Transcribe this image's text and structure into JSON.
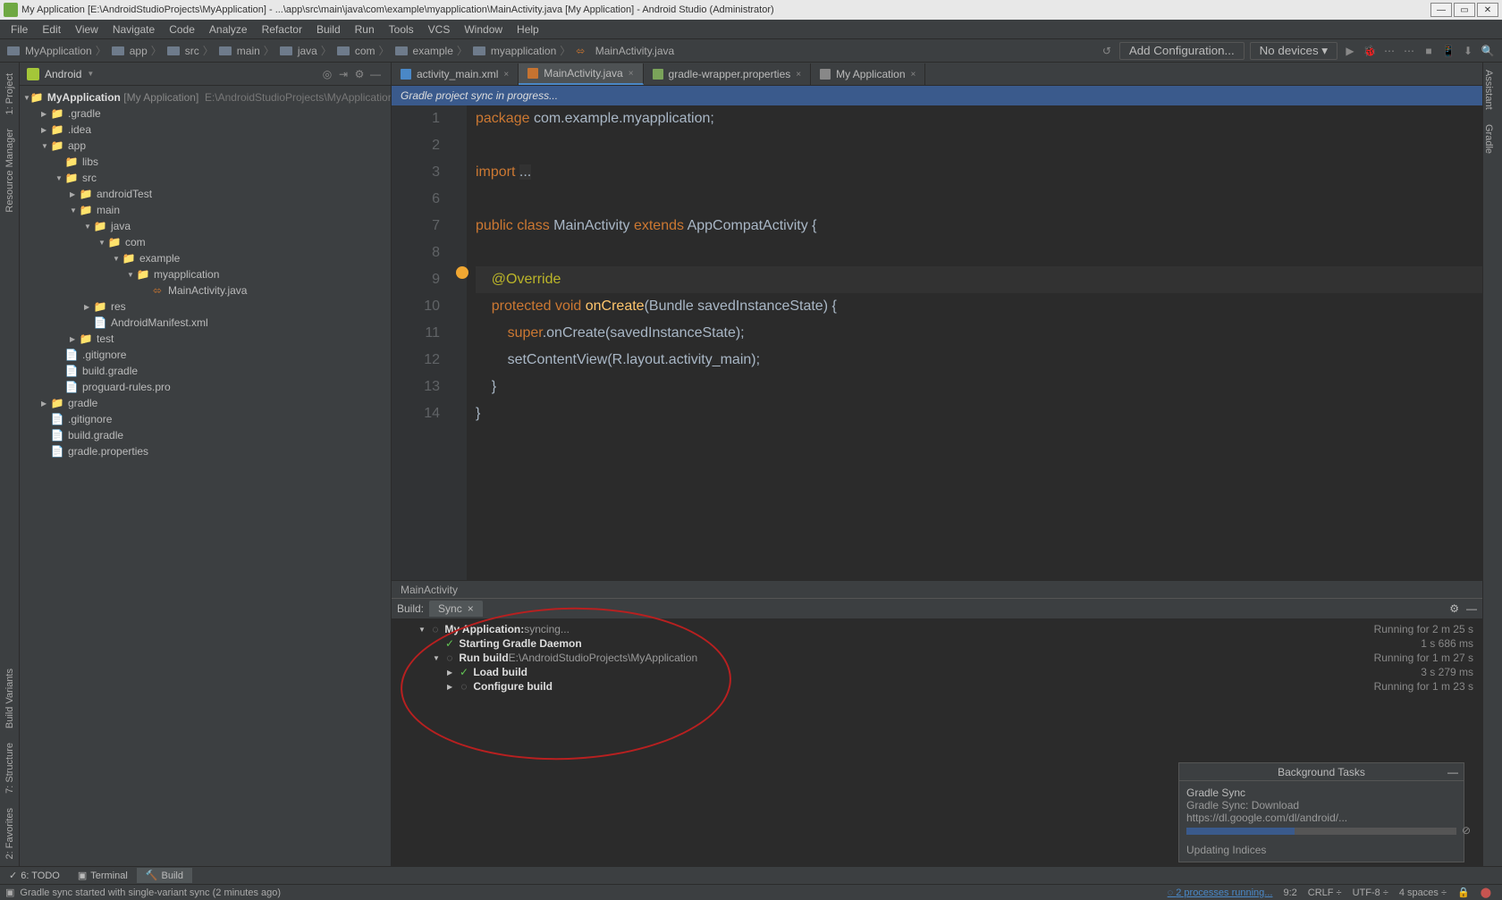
{
  "window": {
    "title": "My Application [E:\\AndroidStudioProjects\\MyApplication] - ...\\app\\src\\main\\java\\com\\example\\myapplication\\MainActivity.java [My Application] - Android Studio (Administrator)"
  },
  "menu": [
    "File",
    "Edit",
    "View",
    "Navigate",
    "Code",
    "Analyze",
    "Refactor",
    "Build",
    "Run",
    "Tools",
    "VCS",
    "Window",
    "Help"
  ],
  "breadcrumbs": [
    "MyApplication",
    "app",
    "src",
    "main",
    "java",
    "com",
    "example",
    "myapplication",
    "MainActivity.java"
  ],
  "toolbar": {
    "add_config": "Add Configuration...",
    "no_devices": "No devices ▾"
  },
  "left_gutters": [
    "1: Project",
    "Resource Manager",
    "Build Variants",
    "7: Structure",
    "2: Favorites"
  ],
  "right_gutters": [
    "Assistant",
    "Gradle"
  ],
  "project_panel": {
    "title": "Android",
    "root": "MyApplication",
    "root_suffix": "[My Application]",
    "root_path": "E:\\AndroidStudioProjects\\MyApplication",
    "tree": [
      {
        "indent": 1,
        "arrow": "▶",
        "icon": "📁",
        "label": ".gradle"
      },
      {
        "indent": 1,
        "arrow": "▶",
        "icon": "📁",
        "label": ".idea"
      },
      {
        "indent": 1,
        "arrow": "▼",
        "icon": "📁",
        "label": "app"
      },
      {
        "indent": 2,
        "arrow": " ",
        "icon": "📁",
        "label": "libs"
      },
      {
        "indent": 2,
        "arrow": "▼",
        "icon": "📁",
        "label": "src"
      },
      {
        "indent": 3,
        "arrow": "▶",
        "icon": "📁",
        "label": "androidTest"
      },
      {
        "indent": 3,
        "arrow": "▼",
        "icon": "📁",
        "label": "main"
      },
      {
        "indent": 4,
        "arrow": "▼",
        "icon": "📁",
        "label": "java"
      },
      {
        "indent": 5,
        "arrow": "▼",
        "icon": "📁",
        "label": "com"
      },
      {
        "indent": 6,
        "arrow": "▼",
        "icon": "📁",
        "label": "example"
      },
      {
        "indent": 7,
        "arrow": "▼",
        "icon": "📁",
        "label": "myapplication"
      },
      {
        "indent": 8,
        "arrow": " ",
        "icon": "J",
        "label": "MainActivity.java"
      },
      {
        "indent": 4,
        "arrow": "▶",
        "icon": "📁",
        "label": "res"
      },
      {
        "indent": 4,
        "arrow": " ",
        "icon": "x",
        "label": "AndroidManifest.xml"
      },
      {
        "indent": 3,
        "arrow": "▶",
        "icon": "📁",
        "label": "test"
      },
      {
        "indent": 2,
        "arrow": " ",
        "icon": "g",
        "label": ".gitignore"
      },
      {
        "indent": 2,
        "arrow": " ",
        "icon": "g",
        "label": "build.gradle"
      },
      {
        "indent": 2,
        "arrow": " ",
        "icon": "g",
        "label": "proguard-rules.pro"
      },
      {
        "indent": 1,
        "arrow": "▶",
        "icon": "📁",
        "label": "gradle"
      },
      {
        "indent": 1,
        "arrow": " ",
        "icon": "g",
        "label": ".gitignore"
      },
      {
        "indent": 1,
        "arrow": " ",
        "icon": "g",
        "label": "build.gradle"
      },
      {
        "indent": 1,
        "arrow": " ",
        "icon": "g",
        "label": "gradle.properties"
      }
    ]
  },
  "tabs": [
    {
      "label": "activity_main.xml",
      "active": false
    },
    {
      "label": "MainActivity.java",
      "active": true
    },
    {
      "label": "gradle-wrapper.properties",
      "active": false
    },
    {
      "label": "My Application",
      "active": false
    }
  ],
  "sync_bar": "Gradle project sync in progress...",
  "code": {
    "lines": [
      "1",
      "2",
      "3",
      "6",
      "7",
      "8",
      "9",
      "10",
      "11",
      "12",
      "13",
      "14"
    ],
    "l1a": "package ",
    "l1b": "com.example.myapplication;",
    "l3a": "import ",
    "l3b": "...",
    "l7a": "public class ",
    "l7b": "MainActivity ",
    "l7c": "extends ",
    "l7d": "AppCompatActivity {",
    "l9": "    @Override",
    "l10a": "    protected void ",
    "l10b": "onCreate",
    "l10c": "(Bundle savedInstanceState) {",
    "l11a": "        super",
    "l11b": ".onCreate(savedInstanceState);",
    "l12": "        setContentView(R.layout.activity_main);",
    "l13": "    }",
    "l14": "}",
    "crumb": "MainActivity"
  },
  "build": {
    "header": "Build:",
    "tab": "Sync",
    "rows": [
      {
        "indent": 0,
        "arrow": "▼",
        "icon": "◌",
        "label": "My Application:",
        "suffix": " syncing..."
      },
      {
        "indent": 1,
        "arrow": " ",
        "icon": "✓",
        "label": "Starting Gradle Daemon"
      },
      {
        "indent": 1,
        "arrow": "▼",
        "icon": "◌",
        "label": "Run build",
        "suffix": " E:\\AndroidStudioProjects\\MyApplication"
      },
      {
        "indent": 2,
        "arrow": "▶",
        "icon": "✓",
        "label": "Load build"
      },
      {
        "indent": 2,
        "arrow": "▶",
        "icon": "◌",
        "label": "Configure build"
      }
    ],
    "timings": [
      "Running for 2 m 25 s",
      "1 s 686 ms",
      "Running for 1 m 27 s",
      "3 s 279 ms",
      "Running for 1 m 23 s"
    ]
  },
  "bgtasks": {
    "title": "Background Tasks",
    "task": "Gradle Sync",
    "detail": "Gradle Sync: Download https://dl.google.com/dl/android/...",
    "more": "Updating Indices"
  },
  "bottom": {
    "todo": "6: TODO",
    "terminal": "Terminal",
    "build": "Build"
  },
  "status": {
    "msg": "Gradle sync started with single-variant sync (2 minutes ago)",
    "procs": "2 processes running...",
    "pos": "9:2",
    "crlf": "CRLF",
    "enc": "UTF-8",
    "indent": "4 spaces"
  }
}
